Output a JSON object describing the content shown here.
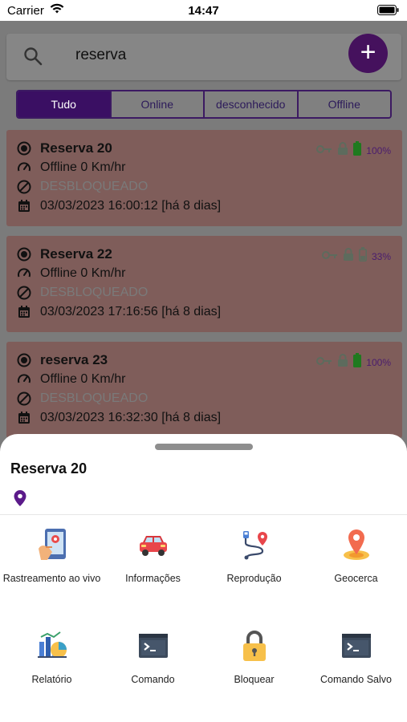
{
  "status_bar": {
    "carrier": "Carrier",
    "time": "14:47"
  },
  "search": {
    "query": "reserva",
    "add_label": "+"
  },
  "filters": [
    {
      "label": "Tudo",
      "active": true
    },
    {
      "label": "Online",
      "active": false
    },
    {
      "label": "desconhecido",
      "active": false
    },
    {
      "label": "Offline",
      "active": false
    }
  ],
  "devices": [
    {
      "name": "Reserva 20",
      "speed": "Offline 0 Km/hr",
      "lock_status": "DESBLOQUEADO",
      "datetime": "03/03/2023 16:00:12 [há 8 dias]",
      "battery": "100%"
    },
    {
      "name": "Reserva 22",
      "speed": "Offline 0 Km/hr",
      "lock_status": "DESBLOQUEADO",
      "datetime": "03/03/2023 17:16:56 [há 8 dias]",
      "battery": "33%"
    },
    {
      "name": "reserva 23",
      "speed": "Offline 0 Km/hr",
      "lock_status": "DESBLOQUEADO",
      "datetime": "03/03/2023 16:32:30 [há 8 dias]",
      "battery": "100%"
    }
  ],
  "sheet": {
    "title": "Reserva 20",
    "actions": [
      {
        "label": "Rastreamento ao vivo",
        "icon": "live-tracking-icon"
      },
      {
        "label": "Informações",
        "icon": "car-info-icon"
      },
      {
        "label": "Reprodução",
        "icon": "route-playback-icon"
      },
      {
        "label": "Geocerca",
        "icon": "geofence-icon"
      },
      {
        "label": "Relatório",
        "icon": "report-icon"
      },
      {
        "label": "Comando",
        "icon": "terminal-icon"
      },
      {
        "label": "Bloquear",
        "icon": "lock-icon"
      },
      {
        "label": "Comando Salvo",
        "icon": "terminal-icon"
      }
    ]
  },
  "colors": {
    "accent": "#5b1a8a",
    "card_bg": "#7f5d5a",
    "battery_green": "#2e8b2e"
  }
}
